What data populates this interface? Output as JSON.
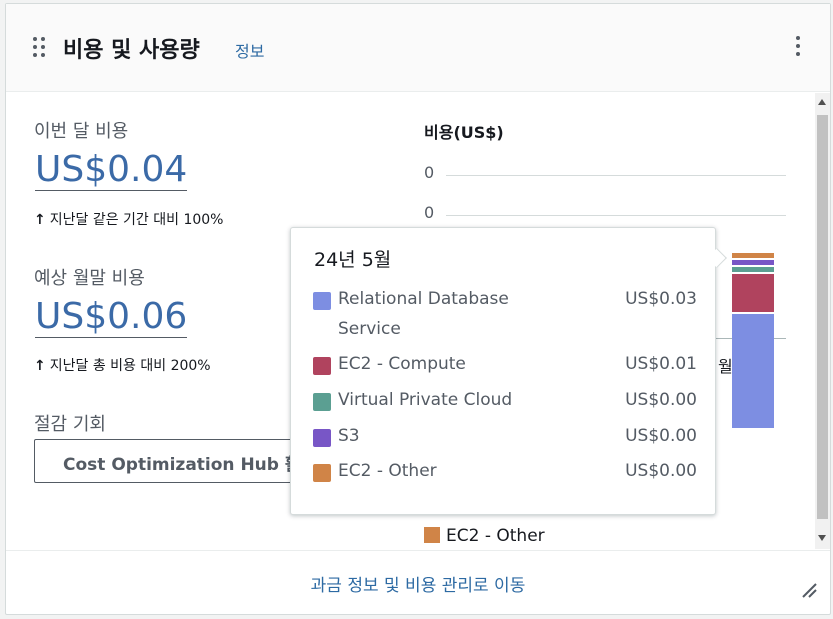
{
  "header": {
    "title": "비용 및 사용량",
    "info_link": "정보"
  },
  "summary": {
    "month_cost_label": "이번 달 비용",
    "month_cost_value": "US$0.04",
    "month_cost_delta": "지난달 같은 기간 대비 100%",
    "forecast_label": "예상 월말 비용",
    "forecast_value": "US$0.06",
    "forecast_delta": "지난달 총 비용 대비 200%",
    "savings_label": "절감 기회",
    "hub_button": "Cost Optimization Hub 활"
  },
  "chart": {
    "title": "비용(US$)",
    "y_ticks": [
      "0",
      "0"
    ],
    "x_tick_partial": "월",
    "legend_visible": "EC2 - Other"
  },
  "chart_data": {
    "type": "bar",
    "title": "비용(US$)",
    "stacked": true,
    "categories": [
      "24년 5월"
    ],
    "series": [
      {
        "name": "Relational Database Service",
        "values": [
          0.03
        ],
        "color": "#7d8ee2"
      },
      {
        "name": "EC2 - Compute",
        "values": [
          0.01
        ],
        "color": "#b0435e"
      },
      {
        "name": "Virtual Private Cloud",
        "values": [
          0.0
        ],
        "color": "#5b9f92"
      },
      {
        "name": "S3",
        "values": [
          0.0
        ],
        "color": "#7856c6"
      },
      {
        "name": "EC2 - Other",
        "values": [
          0.0
        ],
        "color": "#d08447"
      }
    ]
  },
  "popover": {
    "title": "24년 5월",
    "rows": [
      {
        "name": "Relational Database Service",
        "value": "US$0.03",
        "color": "#7d8ee2"
      },
      {
        "name": "EC2 - Compute",
        "value": "US$0.01",
        "color": "#b0435e"
      },
      {
        "name": "Virtual Private Cloud",
        "value": "US$0.00",
        "color": "#5b9f92"
      },
      {
        "name": "S3",
        "value": "US$0.00",
        "color": "#7856c6"
      },
      {
        "name": "EC2 - Other",
        "value": "US$0.00",
        "color": "#d08447"
      }
    ]
  },
  "footer": {
    "link": "과금 정보 및 비용 관리로 이동"
  },
  "colors": {
    "link": "#2d6aa3",
    "value": "#3b6aa7"
  }
}
